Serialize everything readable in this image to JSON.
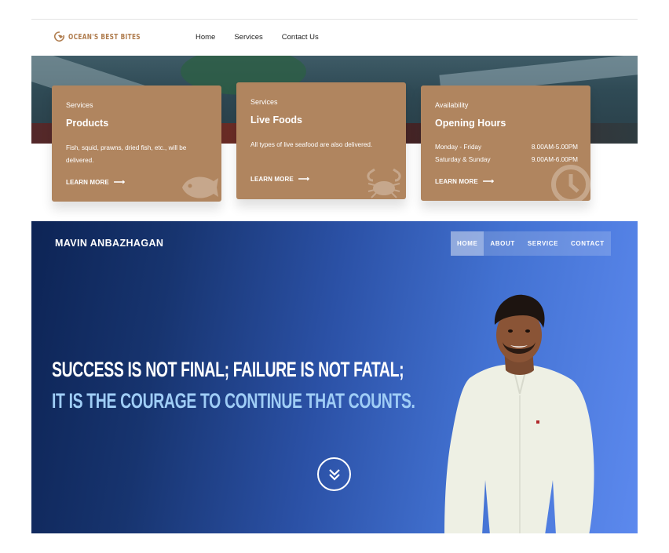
{
  "site": {
    "logo_text": "OCEAN'S BEST BITES",
    "nav": [
      "Home",
      "Services",
      "Contact Us"
    ]
  },
  "cards": [
    {
      "category": "Services",
      "title": "Products",
      "description": "Fish, squid, prawns, dried fish, etc., will be delivered.",
      "link": "LEARN MORE",
      "icon": "fish-icon"
    },
    {
      "category": "Services",
      "title": "Live Foods",
      "description": "All types of live seafood are also delivered.",
      "link": "LEARN MORE",
      "icon": "crab-icon"
    },
    {
      "category": "Availability",
      "title": "Opening Hours",
      "hours": [
        {
          "day": "Monday - Friday",
          "time": "8.00AM-5.00PM"
        },
        {
          "day": "Saturday & Sunday",
          "time": "9.00AM-6.00PM"
        }
      ],
      "link": "LEARN MORE",
      "icon": "clock-icon"
    }
  ],
  "portfolio": {
    "brand": "MAVIN ANBAZHAGAN",
    "nav": [
      "HOME",
      "ABOUT",
      "SERVICE",
      "CONTACT"
    ],
    "active_nav": "HOME",
    "quote_line1": "SUCCESS IS NOT FINAL; FAILURE IS NOT FATAL;",
    "quote_line2": "IT IS THE COURAGE TO CONTINUE THAT COUNTS.",
    "scroll_icon": "double-chevron-down-icon"
  },
  "colors": {
    "card_bg": "#b0855f",
    "logo": "#b07d4f",
    "portfolio_dark": "#0d2455",
    "portfolio_light": "#5c89ee",
    "quote_accent": "#9fcdf6"
  }
}
